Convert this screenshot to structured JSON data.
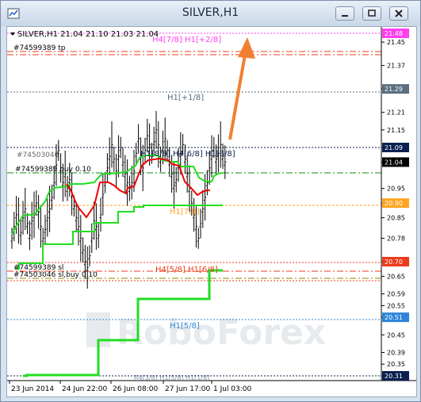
{
  "window": {
    "title": "SILVER,H1"
  },
  "header": {
    "symbol_line": "SILVER,H1  21.04  21.10  21.03  21.04"
  },
  "colors": {
    "bull_bear": "#000000",
    "green_line": "#22dd22",
    "red_line": "#ee0000",
    "arrow": "#f08030",
    "dark_tag": "#0a2050",
    "blue_tag": "#2f84d9",
    "red_tag": "#ee3b1b",
    "orange_tag": "#ffa520",
    "magenta_tag": "#ff3ff0",
    "gray_tag": "#5a6e7f"
  },
  "price_axis": {
    "ticks": [
      "21.45",
      "21.37",
      "21.29",
      "21.21",
      "21.15",
      "21.09",
      "21.04",
      "20.95",
      "20.90",
      "20.85",
      "20.78",
      "20.70",
      "20.65",
      "20.59",
      "20.55",
      "20.51",
      "20.45",
      "20.39",
      "20.35",
      "20.31"
    ],
    "tags": [
      {
        "text": "21.48",
        "style": "magenta"
      },
      {
        "text": "21.29",
        "style": "gray"
      },
      {
        "text": "21.09",
        "style": "dark"
      },
      {
        "text": "21.04",
        "style": "black"
      },
      {
        "text": "20.90",
        "style": "orange"
      },
      {
        "text": "20.70",
        "style": "red"
      },
      {
        "text": "20.51",
        "style": "blue"
      },
      {
        "text": "20.31",
        "style": "dark"
      }
    ]
  },
  "time_axis": {
    "labels": [
      "23 Jun 2014",
      "24 Jun 22:00",
      "26 Jun 08:00",
      "27 Jun 17:00",
      "1 Jul 03:00"
    ]
  },
  "annotations": {
    "order_tp": "#74599389 tp",
    "order_buy_top": "#74503046",
    "order_buy": "#74599389 buy 0.10",
    "order_sl": "#74599389 sl",
    "order_sl2": "#74503046 sl,buy 0.10",
    "level_h4_78_h1_28": "H4[7/8] H1[+2/8]",
    "level_h1_18": "H1[+1/8]",
    "level_h1_88": "H1[8/8] H4[6/8] H1[8/8]",
    "level_h1_78": "H1[7/8]",
    "level_h4_58_h1_68": "H4[5/8] H1[6/8]",
    "level_h1_58": "H1[5/8]",
    "level_bottom": "R4[3/8] H1[5/8] H1[1/8]"
  },
  "watermark": {
    "text": "RoboForex"
  }
}
